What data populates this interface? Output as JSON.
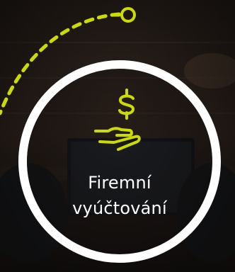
{
  "card": {
    "title_line1": "Firemní",
    "title_line2": "vyúčtování",
    "icon": "hand-dollar-icon"
  },
  "colors": {
    "accent": "#cddc00",
    "ring": "#ffffff",
    "text": "#ffffff",
    "background": "#2b2420"
  }
}
